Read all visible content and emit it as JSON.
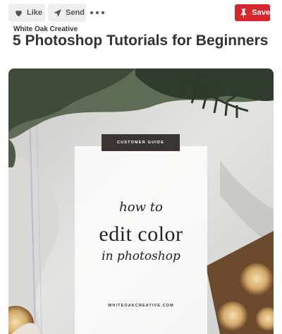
{
  "toolbar": {
    "like_label": "Like",
    "send_label": "Send",
    "save_label": "Save",
    "like_icon": "heart-icon",
    "send_icon": "paper-plane-icon",
    "save_icon": "pushpin-icon",
    "more_icon": "more-options-icon",
    "save_color": "#d7272e"
  },
  "pin": {
    "source": "White Oak Creative",
    "title": "5 Photoshop Tutorials for Beginners"
  },
  "image": {
    "tag": "CUSTOMER GUIDE",
    "line1": "how to",
    "line2": "edit color",
    "line3": "in photoshop",
    "website": "WHITEOAKCREATIVE.COM"
  }
}
